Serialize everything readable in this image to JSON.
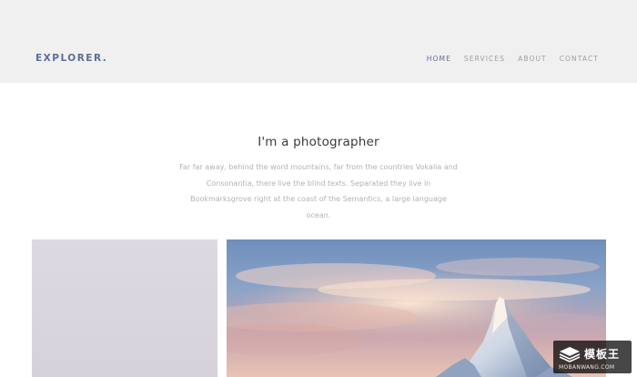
{
  "header": {
    "brand": "EXPLORER.",
    "nav": [
      {
        "label": "HOME",
        "active": true
      },
      {
        "label": "SERVICES",
        "active": false
      },
      {
        "label": "ABOUT",
        "active": false
      },
      {
        "label": "CONTACT",
        "active": false
      }
    ]
  },
  "intro": {
    "title": "I'm a photographer",
    "body": "Far far away, behind the word mountains, far from the countries Vokalia and Consonantia, there live the blind texts. Separated they live in Bookmarksgrove right at the coast of the Semantics, a large language ocean."
  },
  "gallery": {
    "photos": [
      {
        "subject": "pale lavender sky"
      },
      {
        "subject": "snowy mountain peak at sunset"
      }
    ]
  },
  "watermark": {
    "title": "模板王",
    "url": "MOBANWANG.COM",
    "icon": "stacked-layers-icon"
  },
  "colors": {
    "header_bg": "#f0f0f0",
    "accent": "#5b6e96",
    "nav_inactive": "#9aa0a6",
    "body_text": "#b3b3b3"
  }
}
